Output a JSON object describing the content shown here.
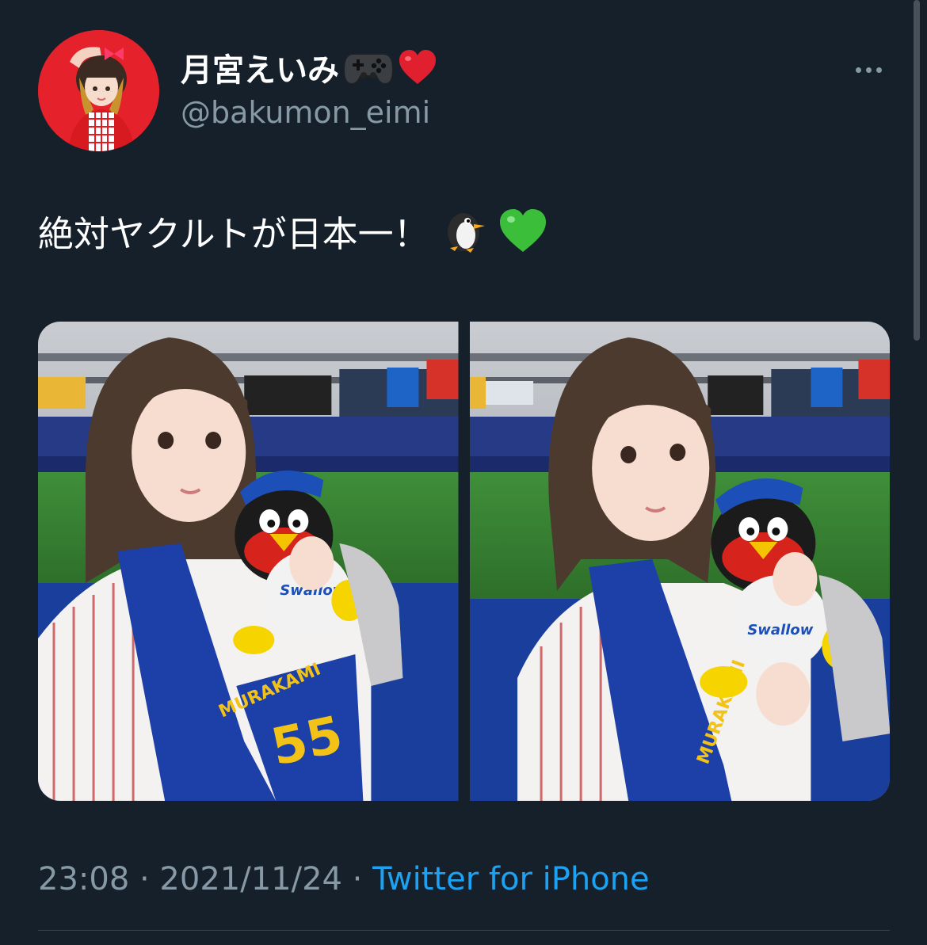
{
  "tweet": {
    "author": {
      "display_name": "月宮えいみ",
      "name_emojis": [
        "game-controller-icon",
        "red-heart-icon"
      ],
      "handle": "@bakumon_eimi"
    },
    "text": "絶対ヤクルトが日本一！",
    "text_emojis": [
      "penguin-icon",
      "green-heart-icon"
    ],
    "timestamp": "23:08 · 2021/11/24 · ",
    "source": "Twitter for iPhone",
    "more_icon": "more-dots-icon"
  },
  "photos": [
    {
      "towel_text_name": "MURAKAMI",
      "towel_number": "55",
      "plush_text": "Swallows"
    },
    {
      "towel_text_name": "MURAKAMI",
      "towel_number": "",
      "plush_text": "Swallow"
    }
  ],
  "colors": {
    "background": "#15202b",
    "secondary_text": "#8899a6",
    "link": "#1da1f2",
    "divider": "#38444d"
  }
}
